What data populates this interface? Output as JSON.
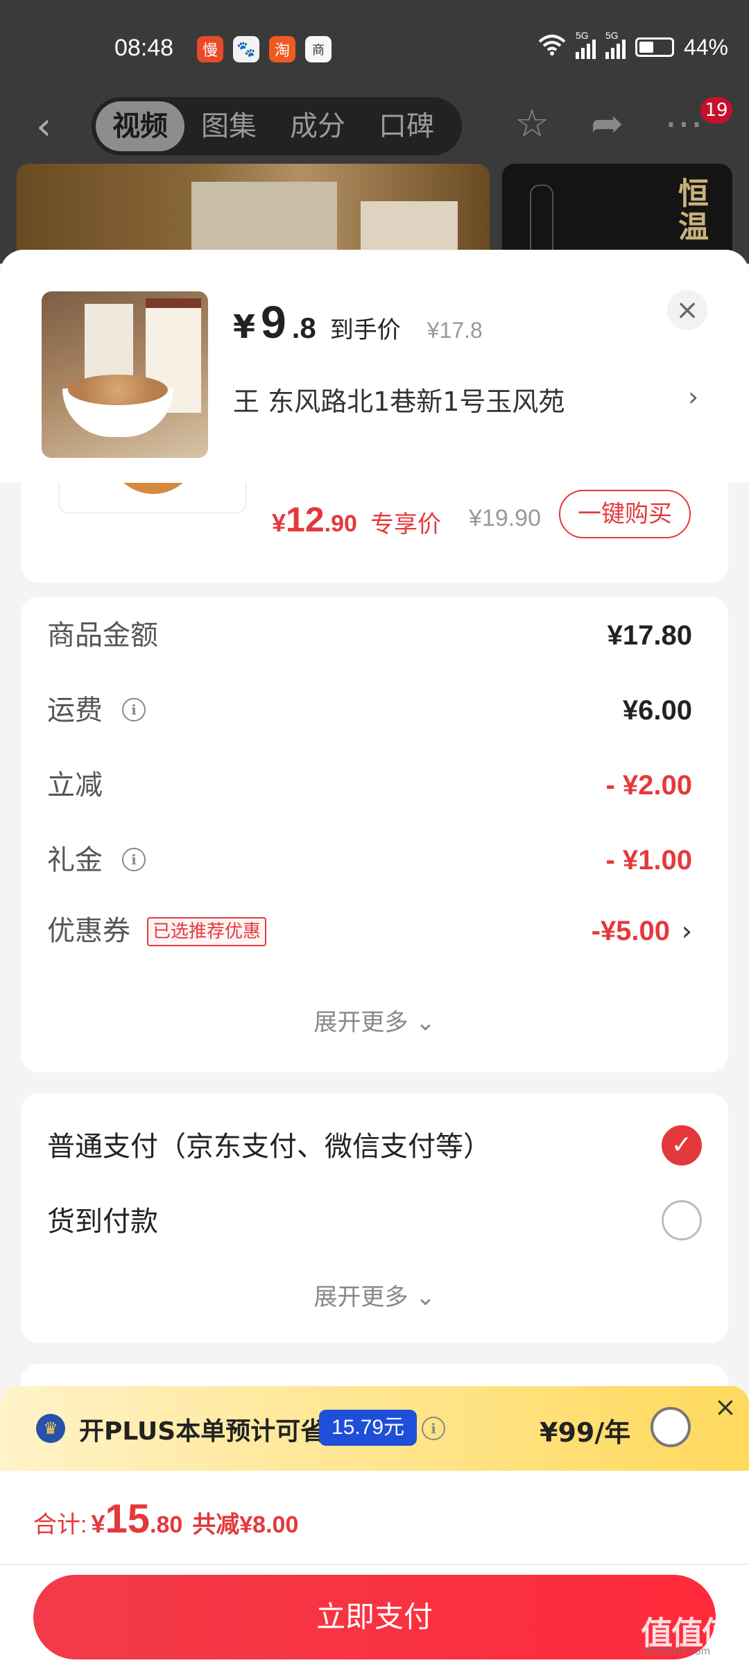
{
  "status_bar": {
    "time": "08:48",
    "app_icons": [
      {
        "name": "man-app-icon",
        "text": "慢",
        "color": "#e84a2a"
      },
      {
        "name": "baidu-app-icon",
        "text": "🐾",
        "color": "#f2f2f2"
      },
      {
        "name": "taobao-app-icon",
        "text": "淘",
        "color": "#f05a22"
      },
      {
        "name": "realme-app-icon",
        "text": "商",
        "color": "#f7f7f7"
      }
    ],
    "signal1": "5G",
    "signal2": "5G",
    "battery": "44%"
  },
  "nav": {
    "tabs": [
      "视频",
      "图集",
      "成分",
      "口碑"
    ],
    "active_tab": "视频",
    "badge": "19"
  },
  "media": {
    "thumb2_title": "恒温"
  },
  "sheet": {
    "price": {
      "currency": "¥",
      "integer": "9",
      "decimal": ".8",
      "label": "到手价",
      "original": "¥17.8"
    },
    "address": "王  东风路北1巷新1号玉风苑",
    "promo": {
      "currency": "¥",
      "integer": "12",
      "decimal": ".90",
      "label": "专享价",
      "original": "¥19.90",
      "button": "一键购买"
    },
    "summary": {
      "goods_label": "商品金额",
      "goods_value": "¥17.80",
      "shipping_label": "运费",
      "shipping_value": "¥6.00",
      "discount_label": "立减",
      "discount_value": "- ¥2.00",
      "gift_label": "礼金",
      "gift_value": "- ¥1.00",
      "coupon_label": "优惠券",
      "coupon_tag": "已选推荐优惠",
      "coupon_value": "-¥5.00",
      "expand": "展开更多 ⌄"
    },
    "payment": {
      "options": [
        {
          "label": "普通支付（京东支付、微信支付等）",
          "selected": true
        },
        {
          "label": "货到付款",
          "selected": false
        }
      ],
      "expand": "展开更多 ⌄"
    }
  },
  "plus": {
    "text": "开PLUS本单预计可省",
    "save": "15.79元",
    "price": "¥99/年"
  },
  "total": {
    "label": "合计:",
    "currency": "¥",
    "integer": "15",
    "decimal": ".80",
    "saved": "共减¥8.00",
    "pay_button": "立即支付"
  },
  "watermark": {
    "text": "值值值",
    "sub": "zhizhizhi.com"
  }
}
